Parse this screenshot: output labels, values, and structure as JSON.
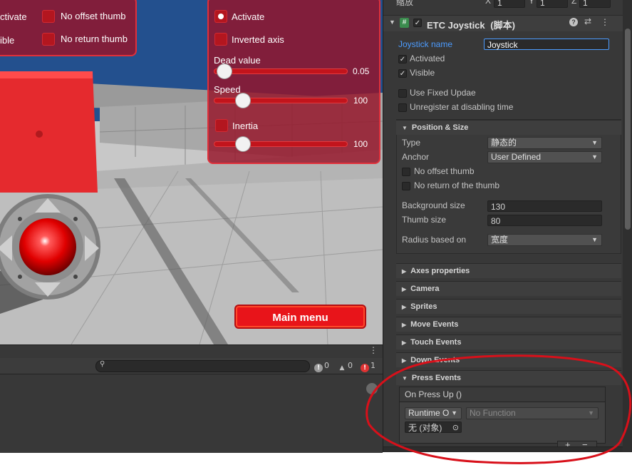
{
  "scene": {
    "left_panel": {
      "toggle1_label": "ctivate",
      "toggle2_label": "ible",
      "no_offset_label": "No offset thumb",
      "no_return_label": "No return thumb"
    },
    "right_panel": {
      "activate_label": "Activate",
      "inverted_label": "Inverted axis",
      "dead_label": "Dead value",
      "dead_value": "0.05",
      "speed_label": "Speed",
      "speed_value": "100",
      "inertia_label": "Inertia",
      "inertia_value": "100"
    },
    "main_menu_label": "Main menu"
  },
  "console": {
    "menu_dots": "⋮",
    "info_count": "0",
    "warn_count": "0",
    "error_count": "1"
  },
  "inspector": {
    "transform": {
      "scale_label": "缩放",
      "x_label": "X",
      "x_value": "1",
      "y_label": "Y",
      "y_value": "1",
      "z_label": "Z",
      "z_value": "1"
    },
    "component": {
      "title": "ETC Joystick",
      "suffix": "(脚本)",
      "script_icon": "#",
      "joystick_name_label": "Joystick name",
      "joystick_name_value": "Joystick",
      "activated_label": "Activated",
      "visible_label": "Visible",
      "use_fixed_label": "Use Fixed Updae",
      "unregister_label": "Unregister at disabling time"
    },
    "position_size": {
      "title": "Position & Size",
      "type_label": "Type",
      "type_value": "静态的",
      "anchor_label": "Anchor",
      "anchor_value": "User Defined",
      "no_offset_label": "No offset thumb",
      "no_return_label": "No return of the thumb",
      "bg_size_label": "Background size",
      "bg_size_value": "130",
      "thumb_size_label": "Thumb size",
      "thumb_size_value": "80",
      "radius_label": "Radius based on",
      "radius_value": "宽度"
    },
    "sections": [
      "Axes properties",
      "Camera",
      "Sprites",
      "Move Events",
      "Touch Events",
      "Down Events"
    ],
    "press_events": {
      "title": "Press Events",
      "on_press_up": "On Press Up ()",
      "runtime_value": "Runtime O",
      "function_value": "No Function",
      "object_value": "无 (对象)"
    }
  },
  "colors": {
    "ui_red": "#b3161f",
    "inspector_bg": "#383838",
    "annotation_red": "#d8101a",
    "link_blue": "#4c9cff"
  }
}
